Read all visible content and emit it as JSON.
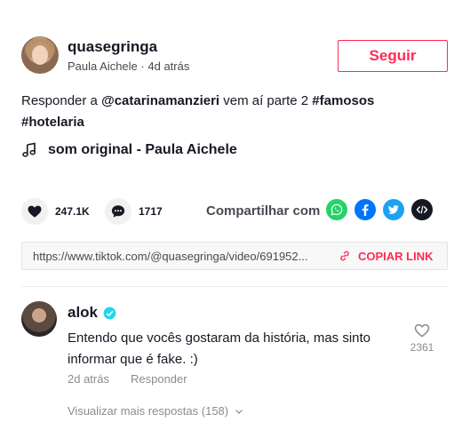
{
  "post": {
    "username": "quasegringa",
    "display_name": "Paula Aichele",
    "separator": "·",
    "time_ago": "4d atrás",
    "follow_label": "Seguir",
    "description_prefix": "Responder a ",
    "mention": "@catarinamanzieri",
    "description_middle": " vem aí parte 2 ",
    "hashtag1": "#famosos",
    "hashtag2": "#hotelaria",
    "music_icon": "music-note-icon",
    "music": "som original - Paula Aichele"
  },
  "actions": {
    "likes": "247.1K",
    "comments": "1717",
    "share_label": "Compartilhar com",
    "share_icons": [
      "whatsapp-icon",
      "facebook-icon",
      "twitter-icon",
      "embed-icon"
    ],
    "colors": {
      "whatsapp": "#25d366",
      "facebook": "#0075fa",
      "twitter": "#1da1f2",
      "embed": "#161823"
    }
  },
  "link": {
    "url": "https://www.tiktok.com/@quasegringa/video/691952...",
    "copy_label": "COPIAR LINK"
  },
  "comment": {
    "username": "alok",
    "verified": true,
    "text": "Entendo que vocês gostaram da história, mas sinto informar que é fake. :)",
    "time_ago": "2d atrás",
    "reply_label": "Responder",
    "like_count": "2361",
    "more_replies": "Visualizar mais respostas (158)"
  },
  "accent_color": "#fe2c55"
}
